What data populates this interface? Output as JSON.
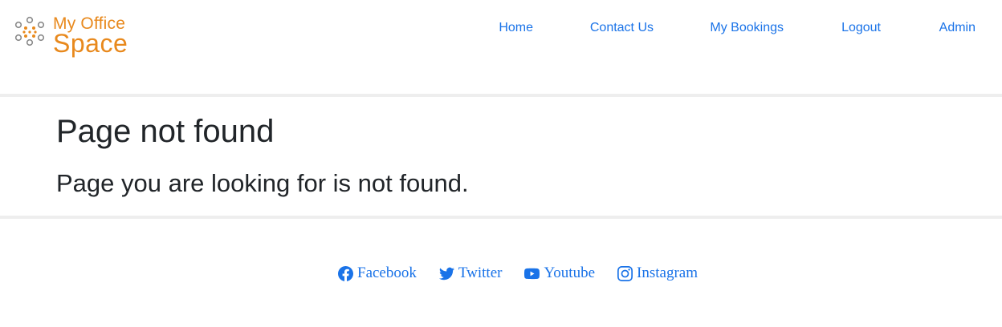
{
  "brand": {
    "line1": "My Office",
    "line2": "Space",
    "color": "#e8891d"
  },
  "nav": {
    "items": [
      {
        "label": "Home"
      },
      {
        "label": "Contact Us"
      },
      {
        "label": "My Bookings"
      },
      {
        "label": "Logout"
      },
      {
        "label": "Admin"
      }
    ],
    "link_color": "#1a73e8"
  },
  "main": {
    "title": "Page not found",
    "message": "Page you are looking for is not found."
  },
  "footer": {
    "social": [
      {
        "label": "Facebook",
        "icon": "facebook-icon"
      },
      {
        "label": "Twitter",
        "icon": "twitter-icon"
      },
      {
        "label": "Youtube",
        "icon": "youtube-icon"
      },
      {
        "label": "Instagram",
        "icon": "instagram-icon"
      }
    ]
  }
}
